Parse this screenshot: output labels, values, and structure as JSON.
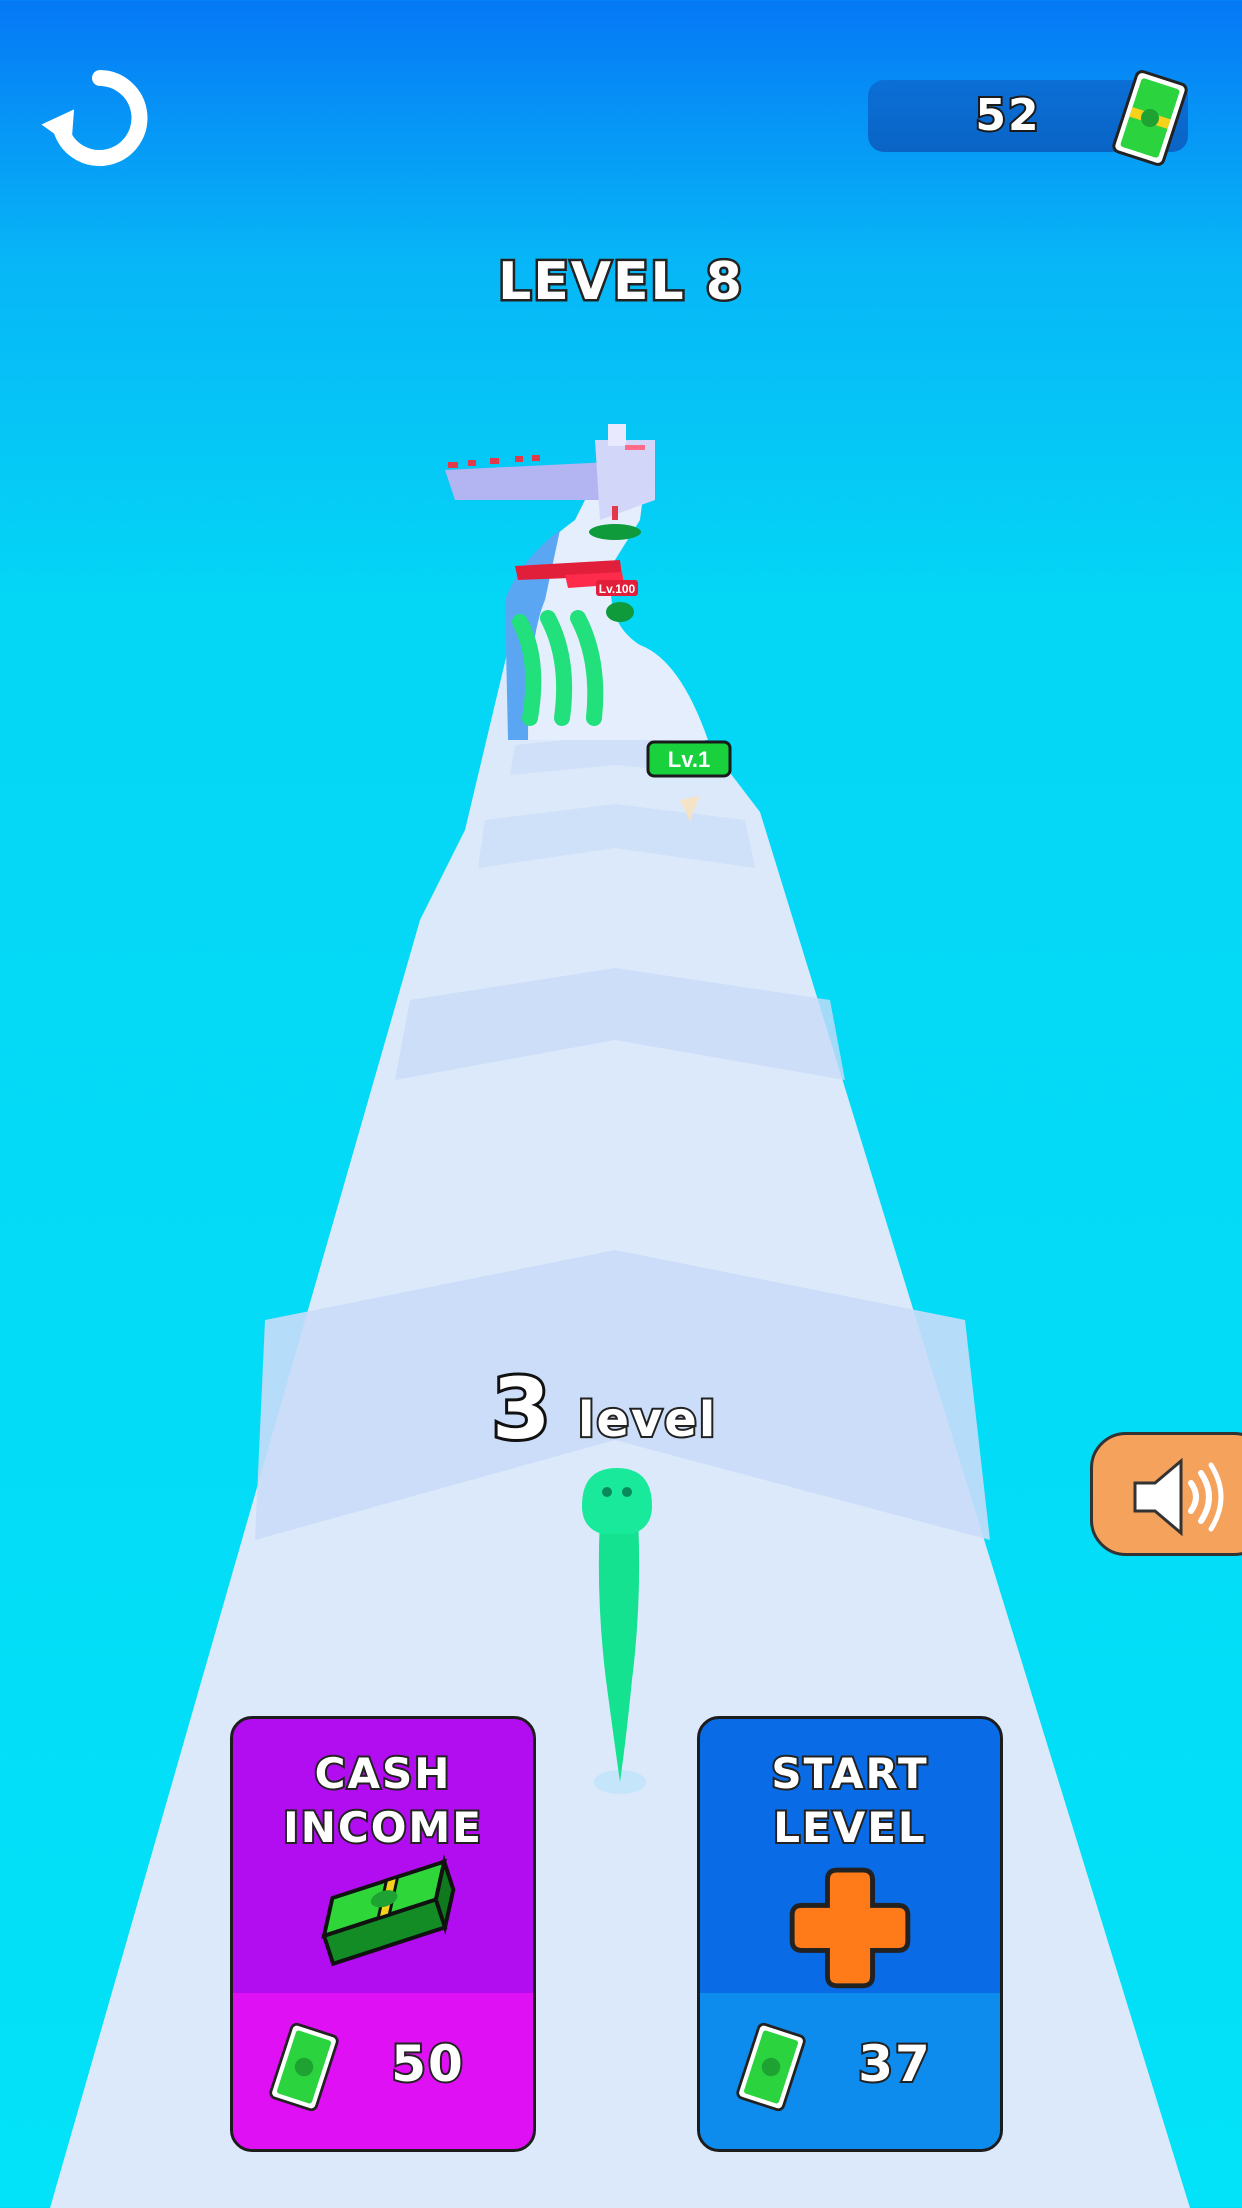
{
  "hud": {
    "cash_amount": "52",
    "level_title": "LEVEL 8"
  },
  "player": {
    "level_number": "3",
    "level_label": "level"
  },
  "track_signs": {
    "gate_low_label": "Lv.1",
    "gate_high_label": "Lv.100"
  },
  "upgrades": [
    {
      "title_line1": "CASH",
      "title_line2": "INCOME",
      "icon": "cash-stack-icon",
      "price": "50",
      "price_icon": "cash-bill-icon",
      "color": "#b20cf1"
    },
    {
      "title_line1": "START",
      "title_line2": "LEVEL",
      "icon": "plus-icon",
      "price": "37",
      "price_icon": "cash-bill-icon",
      "color": "#0a6be6"
    }
  ],
  "buttons": {
    "restart_icon": "restart-icon",
    "sound_icon": "speaker-on-icon"
  },
  "colors": {
    "sky_top": "#0578f5",
    "sky_bottom": "#02e2f8",
    "track": "#dbeafc",
    "snake": "#14e291",
    "sound_button": "#f4a25c"
  }
}
